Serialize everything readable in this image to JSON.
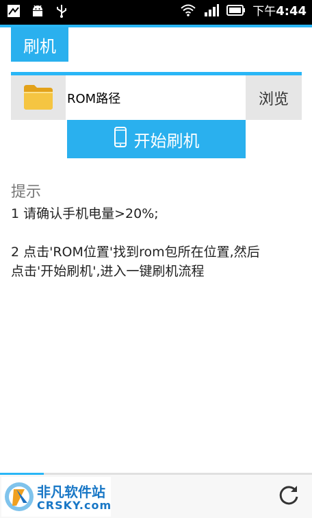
{
  "status_bar": {
    "time_ampm": "下午",
    "time": "4:44",
    "icons_left": [
      "notification-icon",
      "android-debug-icon",
      "usb-icon"
    ],
    "icons_right": [
      "wifi-icon",
      "signal-icon",
      "battery-icon"
    ]
  },
  "header": {
    "title": "刷机"
  },
  "rom": {
    "path_label": "ROM路径",
    "browse_label": "浏览",
    "folder_icon": "folder-icon"
  },
  "actions": {
    "start_flash_label": "开始刷机",
    "phone_icon": "phone-icon"
  },
  "tips": {
    "title": "提示",
    "line1": "1 请确认手机电量>20%;",
    "line2a": "2 点击'ROM位置'找到rom包所在位置,然后",
    "line2b": "点击'开始刷机',进入一键刷机流程"
  },
  "bottom": {
    "watermark_text": "非凡软件站",
    "watermark_sub": "CRSKY.com",
    "refresh_icon": "refresh-icon"
  },
  "colors": {
    "accent": "#2ab0ee",
    "panel": "#e6e6e6"
  }
}
